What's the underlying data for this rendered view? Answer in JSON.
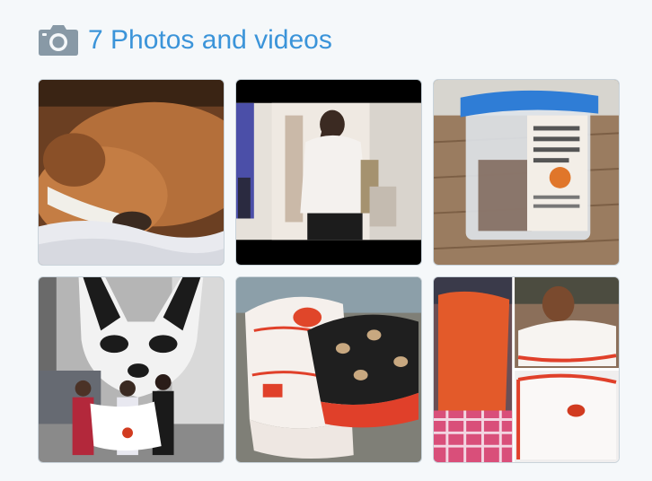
{
  "media": {
    "icon": "camera-icon",
    "title": "7 Photos and videos",
    "accent": "#3b94d9",
    "icon_color": "#8899a6",
    "items": [
      {
        "subject": "dog-sleeping-on-blanket"
      },
      {
        "subject": "girl-carrying-box-video"
      },
      {
        "subject": "donation-jar"
      },
      {
        "subject": "students-holding-blanket-under-dog-mural"
      },
      {
        "subject": "folded-fleece-blankets"
      },
      {
        "subject": "blanket-collage"
      }
    ]
  }
}
